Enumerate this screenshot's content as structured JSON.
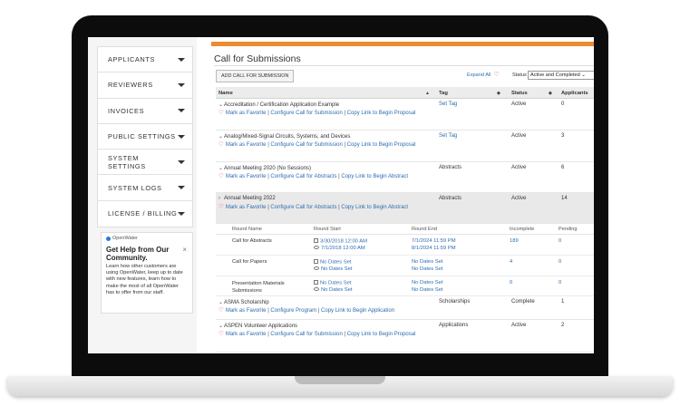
{
  "sidebar": {
    "items": [
      {
        "label": "APPLICANTS"
      },
      {
        "label": "REVIEWERS"
      },
      {
        "label": "INVOICES"
      },
      {
        "label": "PUBLIC SETTINGS"
      },
      {
        "label": "SYSTEM SETTINGS"
      },
      {
        "label": "SYSTEM LOGS"
      },
      {
        "label": "LICENSE / BILLING"
      }
    ],
    "help": {
      "brand": "OpenWater",
      "title": "Get Help from Our Community.",
      "text": "Learn how other customers are using OpenWater, keep up to date with new features, learn how to make the most of all OpenWater has to offer from our staff.",
      "close": "×"
    }
  },
  "main": {
    "title": "Call for Submissions",
    "add_button": "ADD CALL FOR SUBMISSION",
    "expand_all": "Expand All",
    "status_label": "Status",
    "status_value": "Active and Completed",
    "columns": {
      "name": "Name",
      "tag": "Tag",
      "status": "Status",
      "applicants": "Applicants"
    },
    "rows": [
      {
        "name": "Accreditation / Certification Application Example",
        "tag": "Set Tag",
        "status": "Active",
        "applicants": "0",
        "a1": "Mark as Favorite",
        "a2": "Configure Call for Submission",
        "a3": "Copy Link to Begin Proposal"
      },
      {
        "name": "Analog/Mixed-Signal Circuits, Systems, and Devices",
        "tag": "Set Tag",
        "status": "Active",
        "applicants": "3",
        "a1": "Mark as Favorite",
        "a2": "Configure Call for Submission",
        "a3": "Copy Link to Begin Proposal"
      },
      {
        "name": "Annual Meeting 2020 (No Sessions)",
        "tag": "Abstracts",
        "status": "Active",
        "applicants": "6",
        "a1": "Mark as Favorite",
        "a2": "Configure Call for Abstracts",
        "a3": "Copy Link to Begin Abstract"
      },
      {
        "name": "Annual Meeting 2022",
        "tag": "Abstracts",
        "status": "Active",
        "applicants": "14",
        "a1": "Mark as Favorite",
        "a2": "Configure Call for Abstracts",
        "a3": "Copy Link to Begin Abstract"
      }
    ],
    "rounds": {
      "head": {
        "name": "Round Name",
        "start": "Round Start",
        "end": "Round End",
        "incomplete": "Incomplete",
        "pending": "Pending"
      },
      "items": [
        {
          "name": "Call for Abstracts",
          "start1": "3/30/2018 12:00 AM",
          "start2": "7/1/2018 12:00 AM",
          "end1": "7/1/2024 11:59 PM",
          "end2": "8/1/2024 11:59 PM",
          "incomplete": "189",
          "pending": "0"
        },
        {
          "name": "Call for Papers",
          "start1": "No Dates Set",
          "start2": "No Dates Set",
          "end1": "No Dates Set",
          "end2": "No Dates Set",
          "incomplete": "4",
          "pending": "0"
        },
        {
          "name": "Presentation Materials Submissions",
          "start1": "No Dates Set",
          "start2": "No Dates Set",
          "end1": "No Dates Set",
          "end2": "No Dates Set",
          "incomplete": "0",
          "pending": "0"
        }
      ]
    },
    "rows2": [
      {
        "name": "ASMA Scholarship",
        "tag": "Scholarships",
        "status": "Complete",
        "applicants": "1",
        "a1": "Mark as Favorite",
        "a2": "Configure Program",
        "a3": "Copy Link to Begin Application"
      },
      {
        "name": "ASPEN Volunteer Applications",
        "tag": "Applications",
        "status": "Active",
        "applicants": "2",
        "a1": "Mark as Favorite",
        "a2": "Configure Call for Submission",
        "a3": "Copy Link to Begin Proposal"
      }
    ]
  },
  "colors": {
    "accent": "#ee8b32",
    "link": "#2e6db0",
    "favorite": "#d9534f"
  }
}
